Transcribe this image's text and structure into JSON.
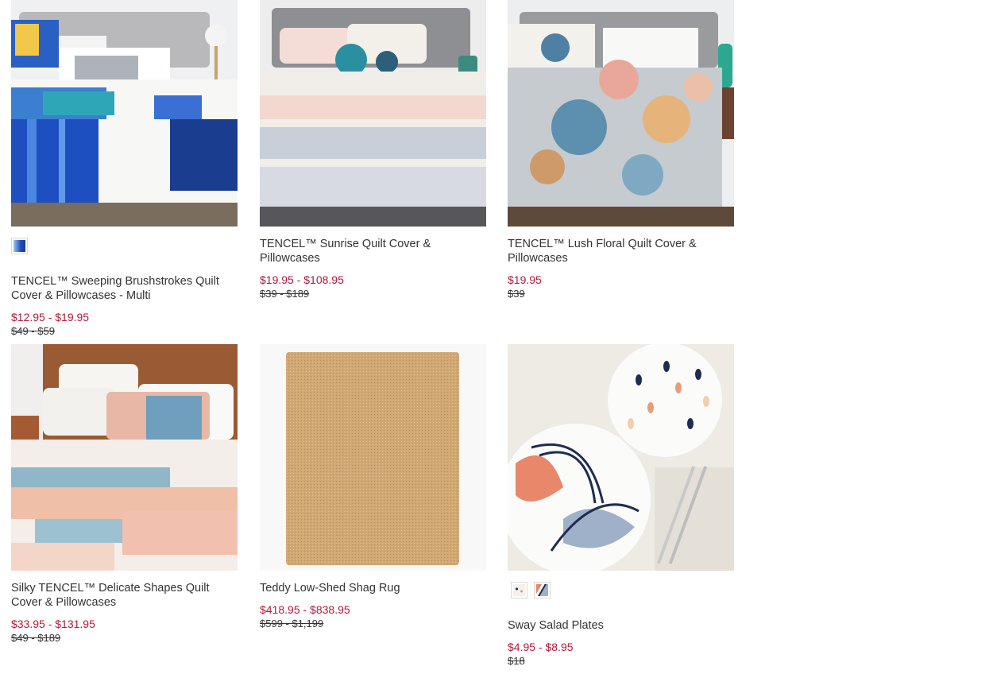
{
  "products": [
    {
      "name": "TENCEL™ Sweeping Brushstrokes Quilt Cover & Pillowcases - Multi",
      "sale_price": "$12.95 - $19.95",
      "regular_price": "$49 - $59",
      "swatches": [
        "blue-brushstroke"
      ]
    },
    {
      "name": "TENCEL™ Sunrise Quilt Cover & Pillowcases",
      "sale_price": "$19.95 - $108.95",
      "regular_price": "$39 - $189",
      "swatches": []
    },
    {
      "name": "TENCEL™ Lush Floral Quilt Cover & Pillowcases",
      "sale_price": "$19.95",
      "regular_price": "$39",
      "swatches": []
    },
    {
      "name": "Silky TENCEL™ Delicate Shapes Quilt Cover & Pillowcases",
      "sale_price": "$33.95 - $131.95",
      "regular_price": "$49 - $189",
      "swatches": []
    },
    {
      "name": "Teddy Low-Shed Shag Rug",
      "sale_price": "$418.95 - $838.95",
      "regular_price": "$599 - $1,199",
      "swatches": []
    },
    {
      "name": "Sway Salad Plates",
      "sale_price": "$4.95 - $8.95",
      "regular_price": "$18",
      "swatches": [
        "dots-pattern",
        "arcs-pattern"
      ]
    }
  ],
  "colors": {
    "sale": "#b3193a",
    "text": "#333333"
  }
}
